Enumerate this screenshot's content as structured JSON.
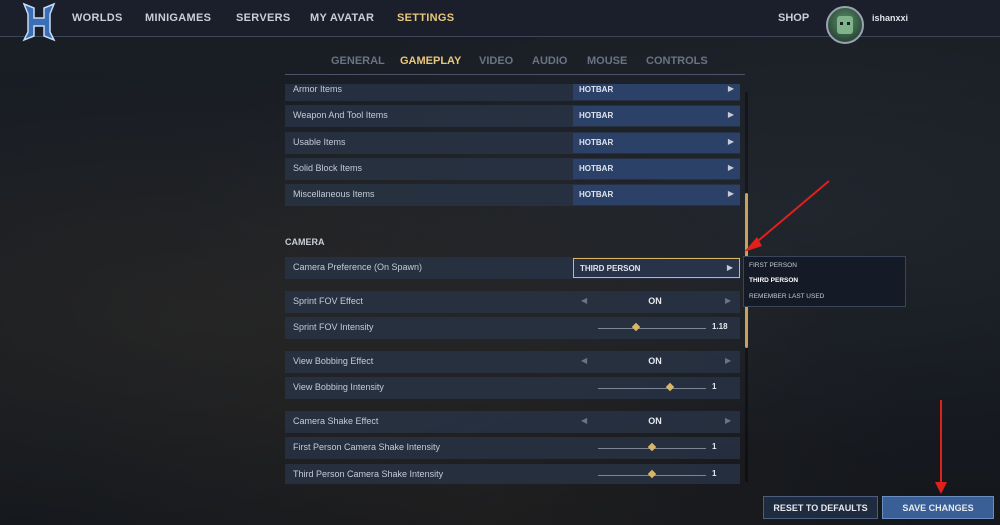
{
  "nav": {
    "items": [
      "WORLDS",
      "MINIGAMES",
      "SERVERS",
      "MY AVATAR",
      "SETTINGS"
    ],
    "active": "SETTINGS",
    "shop": "SHOP",
    "username": "ishanxxi"
  },
  "tabs": {
    "items": [
      "GENERAL",
      "GAMEPLAY",
      "VIDEO",
      "AUDIO",
      "MOUSE",
      "CONTROLS"
    ],
    "active": "GAMEPLAY"
  },
  "items_section": {
    "rows": [
      {
        "label": "Armor Items",
        "value": "HOTBAR"
      },
      {
        "label": "Weapon And Tool Items",
        "value": "HOTBAR"
      },
      {
        "label": "Usable Items",
        "value": "HOTBAR"
      },
      {
        "label": "Solid Block Items",
        "value": "HOTBAR"
      },
      {
        "label": "Miscellaneous Items",
        "value": "HOTBAR"
      }
    ]
  },
  "camera": {
    "title": "CAMERA",
    "preference": {
      "label": "Camera Preference (On Spawn)",
      "value": "THIRD PERSON"
    },
    "sprint_fov_effect": {
      "label": "Sprint FOV Effect",
      "value": "ON"
    },
    "sprint_fov_intensity": {
      "label": "Sprint FOV Intensity",
      "value": "1.18",
      "level": 0.35
    },
    "view_bobbing_effect": {
      "label": "View Bobbing Effect",
      "value": "ON"
    },
    "view_bobbing_intensity": {
      "label": "View Bobbing Intensity",
      "value": "1",
      "level": 0.67
    },
    "camera_shake_effect": {
      "label": "Camera Shake Effect",
      "value": "ON"
    },
    "first_person_shake": {
      "label": "First Person Camera Shake Intensity",
      "value": "1",
      "level": 0.5
    },
    "third_person_shake": {
      "label": "Third Person Camera Shake Intensity",
      "value": "1",
      "level": 0.5
    }
  },
  "dropdown": {
    "options": [
      "FIRST PERSON",
      "THIRD PERSON",
      "REMEMBER LAST USED"
    ],
    "selected": "THIRD PERSON"
  },
  "buttons": {
    "reset": "RESET TO DEFAULTS",
    "save": "SAVE CHANGES"
  },
  "colors": {
    "accent": "#e9c77a",
    "save_button": "#3a5f96",
    "annotation_arrow": "#e0201b"
  }
}
